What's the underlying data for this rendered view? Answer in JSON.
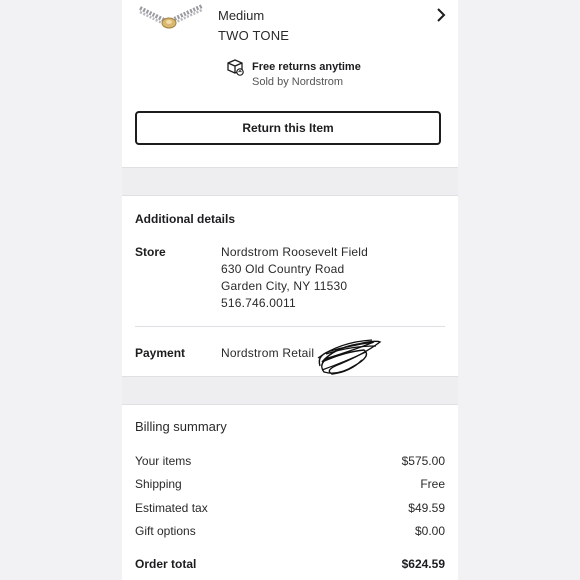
{
  "item": {
    "image_icon": "bracelet-thumbnail-icon",
    "size": "Medium",
    "color": "TWO TONE",
    "chevron_icon": "chevron-right-icon"
  },
  "returns": {
    "icon": "return-box-icon",
    "title": "Free returns anytime",
    "sold_by": "Sold by Nordstrom",
    "button_label": "Return this Item"
  },
  "additional_details": {
    "title": "Additional details",
    "store_label": "Store",
    "store_lines": [
      "Nordstrom Roosevelt Field",
      "630 Old Country Road",
      "Garden City, NY 11530",
      "516.746.0011"
    ],
    "payment_label": "Payment",
    "payment_value": "Nordstrom Retail"
  },
  "billing": {
    "title": "Billing summary",
    "rows": [
      {
        "label": "Your items",
        "value": "$575.00"
      },
      {
        "label": "Shipping",
        "value": "Free"
      },
      {
        "label": "Estimated tax",
        "value": "$49.59"
      },
      {
        "label": "Gift options",
        "value": "$0.00"
      }
    ],
    "total_label": "Order total",
    "total_value": "$624.59"
  },
  "colors": {
    "page_bg": "#f2f2f4",
    "band": "#eeeef1",
    "text": "#1d1d1f"
  }
}
